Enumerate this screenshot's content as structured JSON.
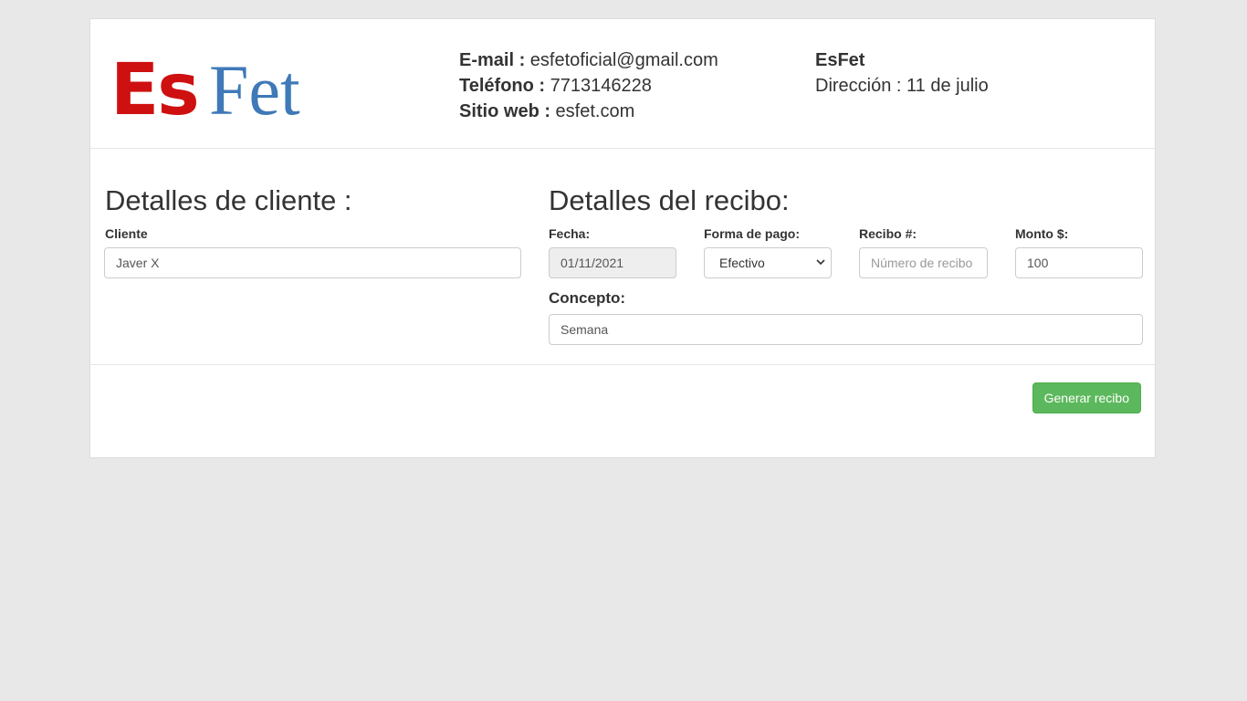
{
  "logo": {
    "part1": "Es",
    "part2": "Fet",
    "colors": {
      "part1": "#cf1010",
      "part2": "#3f79b8"
    }
  },
  "contact": {
    "email_label": "E-mail :",
    "email_value": " esfetoficial@gmail.com",
    "phone_label": "Teléfono :",
    "phone_value": " 7713146228",
    "web_label": "Sitio web :",
    "web_value": " esfet.com"
  },
  "company": {
    "name": "EsFet",
    "address": "Dirección : 11 de julio"
  },
  "client": {
    "heading": "Detalles de cliente :",
    "cliente_label": "Cliente",
    "cliente_value": "Javer X"
  },
  "receipt": {
    "heading": "Detalles del recibo:",
    "fecha_label": "Fecha:",
    "fecha_value": "01/11/2021",
    "pago_label": "Forma de pago:",
    "pago_selected": "Efectivo",
    "recibo_label": "Recibo #:",
    "recibo_placeholder": "Número de recibo",
    "monto_label": "Monto $:",
    "monto_value": "100",
    "concepto_label": "Concepto:",
    "concepto_value": "Semana"
  },
  "actions": {
    "generate_label": "Generar recibo",
    "button_color": "#5cb85c"
  }
}
